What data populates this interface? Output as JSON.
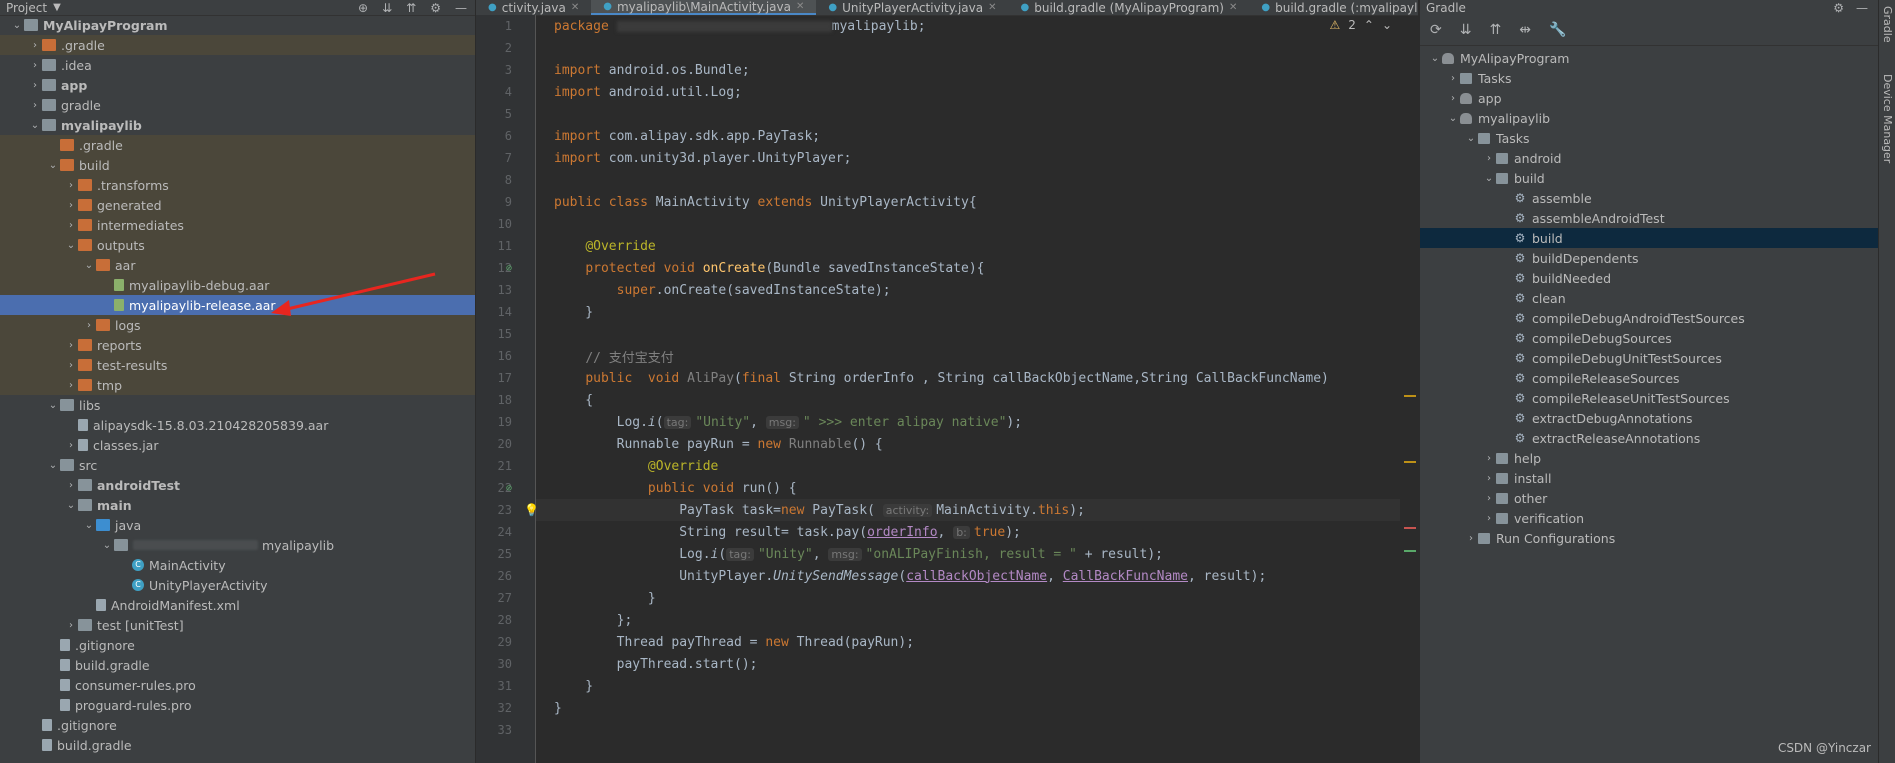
{
  "project": {
    "title": "Project",
    "tree": [
      {
        "label": "MyAlipayProgram",
        "indent": 0,
        "chev": "v",
        "icon": "folder-g",
        "bold": true,
        "bg": ""
      },
      {
        "label": ".gradle",
        "indent": 1,
        "chev": ">",
        "icon": "folder-o",
        "bold": false,
        "bg": "ex"
      },
      {
        "label": ".idea",
        "indent": 1,
        "chev": ">",
        "icon": "folder-g",
        "bold": false,
        "bg": ""
      },
      {
        "label": "app",
        "indent": 1,
        "chev": ">",
        "icon": "folder-g",
        "bold": true,
        "bg": ""
      },
      {
        "label": "gradle",
        "indent": 1,
        "chev": ">",
        "icon": "folder-g",
        "bold": false,
        "bg": ""
      },
      {
        "label": "myalipaylib",
        "indent": 1,
        "chev": "v",
        "icon": "folder-g",
        "bold": true,
        "bg": ""
      },
      {
        "label": ".gradle",
        "indent": 2,
        "chev": "",
        "icon": "folder-o",
        "bold": false,
        "bg": "ex"
      },
      {
        "label": "build",
        "indent": 2,
        "chev": "v",
        "icon": "folder-o",
        "bold": false,
        "bg": "ex"
      },
      {
        "label": ".transforms",
        "indent": 3,
        "chev": ">",
        "icon": "folder-o",
        "bold": false,
        "bg": "ex"
      },
      {
        "label": "generated",
        "indent": 3,
        "chev": ">",
        "icon": "folder-o",
        "bold": false,
        "bg": "ex"
      },
      {
        "label": "intermediates",
        "indent": 3,
        "chev": ">",
        "icon": "folder-o",
        "bold": false,
        "bg": "ex"
      },
      {
        "label": "outputs",
        "indent": 3,
        "chev": "v",
        "icon": "folder-o",
        "bold": false,
        "bg": "ex"
      },
      {
        "label": "aar",
        "indent": 4,
        "chev": "v",
        "icon": "folder-o",
        "bold": false,
        "bg": "ex"
      },
      {
        "label": "myalipaylib-debug.aar",
        "indent": 5,
        "chev": "",
        "icon": "file-gr",
        "bold": false,
        "bg": "ex"
      },
      {
        "label": "myalipaylib-release.aar",
        "indent": 5,
        "chev": "",
        "icon": "file-gr",
        "bold": false,
        "bg": "sel"
      },
      {
        "label": "logs",
        "indent": 4,
        "chev": ">",
        "icon": "folder-o",
        "bold": false,
        "bg": "ex"
      },
      {
        "label": "reports",
        "indent": 3,
        "chev": ">",
        "icon": "folder-o",
        "bold": false,
        "bg": "ex"
      },
      {
        "label": "test-results",
        "indent": 3,
        "chev": ">",
        "icon": "folder-o",
        "bold": false,
        "bg": "ex"
      },
      {
        "label": "tmp",
        "indent": 3,
        "chev": ">",
        "icon": "folder-o",
        "bold": false,
        "bg": "ex"
      },
      {
        "label": "libs",
        "indent": 2,
        "chev": "v",
        "icon": "folder-g",
        "bold": false,
        "bg": ""
      },
      {
        "label": "alipaysdk-15.8.03.210428205839.aar",
        "indent": 3,
        "chev": "",
        "icon": "file",
        "bold": false,
        "bg": ""
      },
      {
        "label": "classes.jar",
        "indent": 3,
        "chev": ">",
        "icon": "file",
        "bold": false,
        "bg": ""
      },
      {
        "label": "src",
        "indent": 2,
        "chev": "v",
        "icon": "folder-g",
        "bold": false,
        "bg": ""
      },
      {
        "label": "androidTest",
        "indent": 3,
        "chev": ">",
        "icon": "folder-g",
        "bold": true,
        "bg": ""
      },
      {
        "label": "main",
        "indent": 3,
        "chev": "v",
        "icon": "folder-g",
        "bold": true,
        "bg": ""
      },
      {
        "label": "java",
        "indent": 4,
        "chev": "v",
        "icon": "folder-b",
        "bold": false,
        "bg": ""
      },
      {
        "label": "myalipaylib",
        "indent": 5,
        "chev": "v",
        "icon": "folder-g",
        "bold": false,
        "bg": "",
        "blurred": true
      },
      {
        "label": "MainActivity",
        "indent": 6,
        "chev": "",
        "icon": "class",
        "bold": false,
        "bg": ""
      },
      {
        "label": "UnityPlayerActivity",
        "indent": 6,
        "chev": "",
        "icon": "class",
        "bold": false,
        "bg": ""
      },
      {
        "label": "AndroidManifest.xml",
        "indent": 4,
        "chev": "",
        "icon": "file",
        "bold": false,
        "bg": ""
      },
      {
        "label": "test [unitTest]",
        "indent": 3,
        "chev": ">",
        "icon": "folder-g",
        "bold": false,
        "bg": ""
      },
      {
        "label": ".gitignore",
        "indent": 2,
        "chev": "",
        "icon": "file",
        "bold": false,
        "bg": ""
      },
      {
        "label": "build.gradle",
        "indent": 2,
        "chev": "",
        "icon": "file",
        "bold": false,
        "bg": ""
      },
      {
        "label": "consumer-rules.pro",
        "indent": 2,
        "chev": "",
        "icon": "file",
        "bold": false,
        "bg": ""
      },
      {
        "label": "proguard-rules.pro",
        "indent": 2,
        "chev": "",
        "icon": "file",
        "bold": false,
        "bg": ""
      },
      {
        "label": ".gitignore",
        "indent": 1,
        "chev": "",
        "icon": "file",
        "bold": false,
        "bg": ""
      },
      {
        "label": "build.gradle",
        "indent": 1,
        "chev": "",
        "icon": "file",
        "bold": false,
        "bg": ""
      }
    ]
  },
  "editor": {
    "tabs": [
      {
        "label": "ctivity.java",
        "active": false
      },
      {
        "label": "myalipaylib\\MainActivity.java",
        "active": true
      },
      {
        "label": "UnityPlayerActivity.java",
        "active": false
      },
      {
        "label": "build.gradle (MyAlipayProgram)",
        "active": false
      },
      {
        "label": "build.gradle (:myalipaylib)",
        "active": false
      }
    ],
    "warning_count": "2",
    "lines": [
      {
        "n": "1",
        "html": "<span class='kw'>package </span><span class='blurcode'></span><span>myalipaylib;</span>"
      },
      {
        "n": "2",
        "html": ""
      },
      {
        "n": "3",
        "html": "<span class='kw'>import </span>android.os.Bundle;"
      },
      {
        "n": "4",
        "html": "<span class='kw'>import </span>android.util.Log;"
      },
      {
        "n": "5",
        "html": ""
      },
      {
        "n": "6",
        "html": "<span class='kw'>import </span>com.alipay.sdk.app.PayTask;"
      },
      {
        "n": "7",
        "html": "<span class='kw'>import </span>com.unity3d.player.UnityPlayer;"
      },
      {
        "n": "8",
        "html": ""
      },
      {
        "n": "9",
        "html": "<span class='kw'>public class </span>MainActivity <span class='kw'>extends </span>UnityPlayerActivity{"
      },
      {
        "n": "10",
        "html": ""
      },
      {
        "n": "11",
        "html": "    <span class='ann'>@Override</span>"
      },
      {
        "n": "12",
        "html": "    <span class='kw'>protected void </span><span class='fn'>onCreate</span>(Bundle savedInstanceState){",
        "mark": true
      },
      {
        "n": "13",
        "html": "        <span class='kw'>super</span>.onCreate(savedInstanceState);"
      },
      {
        "n": "14",
        "html": "    }"
      },
      {
        "n": "15",
        "html": ""
      },
      {
        "n": "16",
        "html": "    <span class='cm'>// 支付宝支付</span>"
      },
      {
        "n": "17",
        "html": "    <span class='kw'>public  void </span><span class='cm'>AliPay</span>(<span class='kw'>final </span>String orderInfo , String callBackObjectName,String CallBackFuncName)"
      },
      {
        "n": "18",
        "html": "    {"
      },
      {
        "n": "19",
        "html": "        Log.<span class='it'>i</span>(<span class='hint'>tag:</span><span class='str'>\"Unity\"</span>, <span class='hint'>msg:</span><span class='str'>\" >>> enter alipay native\"</span>);"
      },
      {
        "n": "20",
        "html": "        Runnable payRun = <span class='kw'>new </span><span class='cm'>Runnable</span>() {"
      },
      {
        "n": "21",
        "html": "            <span class='ann'>@Override</span>"
      },
      {
        "n": "22",
        "html": "            <span class='kw'>public void </span>run() {",
        "mark": true
      },
      {
        "n": "23",
        "html": "                PayTask task=<span class='kw'>new </span>PayTask( <span class='hint'>activity:</span>MainActivity.<span class='kw'>this</span>);",
        "cur": true,
        "bulb": true
      },
      {
        "n": "24",
        "html": "                String result= task.pay(<span class='pm'>orderInfo</span>, <span class='hint'>b:</span><span class='kw'>true</span>);"
      },
      {
        "n": "25",
        "html": "                Log.<span class='it'>i</span>(<span class='hint'>tag:</span><span class='str'>\"Unity\"</span>, <span class='hint'>msg:</span><span class='str'>\"onALIPayFinish, result = \"</span> + result);"
      },
      {
        "n": "26",
        "html": "                UnityPlayer.<span class='it'>UnitySendMessage</span>(<span class='pm'>callBackObjectName</span>, <span class='pm'>CallBackFuncName</span>, result);"
      },
      {
        "n": "27",
        "html": "            }"
      },
      {
        "n": "28",
        "html": "        };"
      },
      {
        "n": "29",
        "html": "        Thread payThread = <span class='kw'>new </span>Thread(payRun);"
      },
      {
        "n": "30",
        "html": "        payThread.start();"
      },
      {
        "n": "31",
        "html": "    }"
      },
      {
        "n": "32",
        "html": "}"
      },
      {
        "n": "33",
        "html": ""
      }
    ]
  },
  "gradle": {
    "title": "Gradle",
    "selected": "build",
    "tree": [
      {
        "label": "MyAlipayProgram",
        "indent": 0,
        "chev": "v",
        "icon": "elephant"
      },
      {
        "label": "Tasks",
        "indent": 1,
        "chev": ">",
        "icon": "folder"
      },
      {
        "label": "app",
        "indent": 1,
        "chev": ">",
        "icon": "elephant"
      },
      {
        "label": "myalipaylib",
        "indent": 1,
        "chev": "v",
        "icon": "elephant"
      },
      {
        "label": "Tasks",
        "indent": 2,
        "chev": "v",
        "icon": "folder"
      },
      {
        "label": "android",
        "indent": 3,
        "chev": ">",
        "icon": "folder"
      },
      {
        "label": "build",
        "indent": 3,
        "chev": "v",
        "icon": "folder"
      },
      {
        "label": "assemble",
        "indent": 4,
        "chev": "",
        "icon": "gear"
      },
      {
        "label": "assembleAndroidTest",
        "indent": 4,
        "chev": "",
        "icon": "gear"
      },
      {
        "label": "build",
        "indent": 4,
        "chev": "",
        "icon": "gear",
        "sel": true
      },
      {
        "label": "buildDependents",
        "indent": 4,
        "chev": "",
        "icon": "gear"
      },
      {
        "label": "buildNeeded",
        "indent": 4,
        "chev": "",
        "icon": "gear"
      },
      {
        "label": "clean",
        "indent": 4,
        "chev": "",
        "icon": "gear"
      },
      {
        "label": "compileDebugAndroidTestSources",
        "indent": 4,
        "chev": "",
        "icon": "gear"
      },
      {
        "label": "compileDebugSources",
        "indent": 4,
        "chev": "",
        "icon": "gear"
      },
      {
        "label": "compileDebugUnitTestSources",
        "indent": 4,
        "chev": "",
        "icon": "gear"
      },
      {
        "label": "compileReleaseSources",
        "indent": 4,
        "chev": "",
        "icon": "gear"
      },
      {
        "label": "compileReleaseUnitTestSources",
        "indent": 4,
        "chev": "",
        "icon": "gear"
      },
      {
        "label": "extractDebugAnnotations",
        "indent": 4,
        "chev": "",
        "icon": "gear"
      },
      {
        "label": "extractReleaseAnnotations",
        "indent": 4,
        "chev": "",
        "icon": "gear"
      },
      {
        "label": "help",
        "indent": 3,
        "chev": ">",
        "icon": "folder"
      },
      {
        "label": "install",
        "indent": 3,
        "chev": ">",
        "icon": "folder"
      },
      {
        "label": "other",
        "indent": 3,
        "chev": ">",
        "icon": "folder"
      },
      {
        "label": "verification",
        "indent": 3,
        "chev": ">",
        "icon": "folder"
      },
      {
        "label": "Run Configurations",
        "indent": 2,
        "chev": ">",
        "icon": "folder"
      }
    ]
  },
  "strip": {
    "gradle_label": "Gradle",
    "device_label": "Device Manager"
  },
  "watermark": "CSDN @Yinczar"
}
